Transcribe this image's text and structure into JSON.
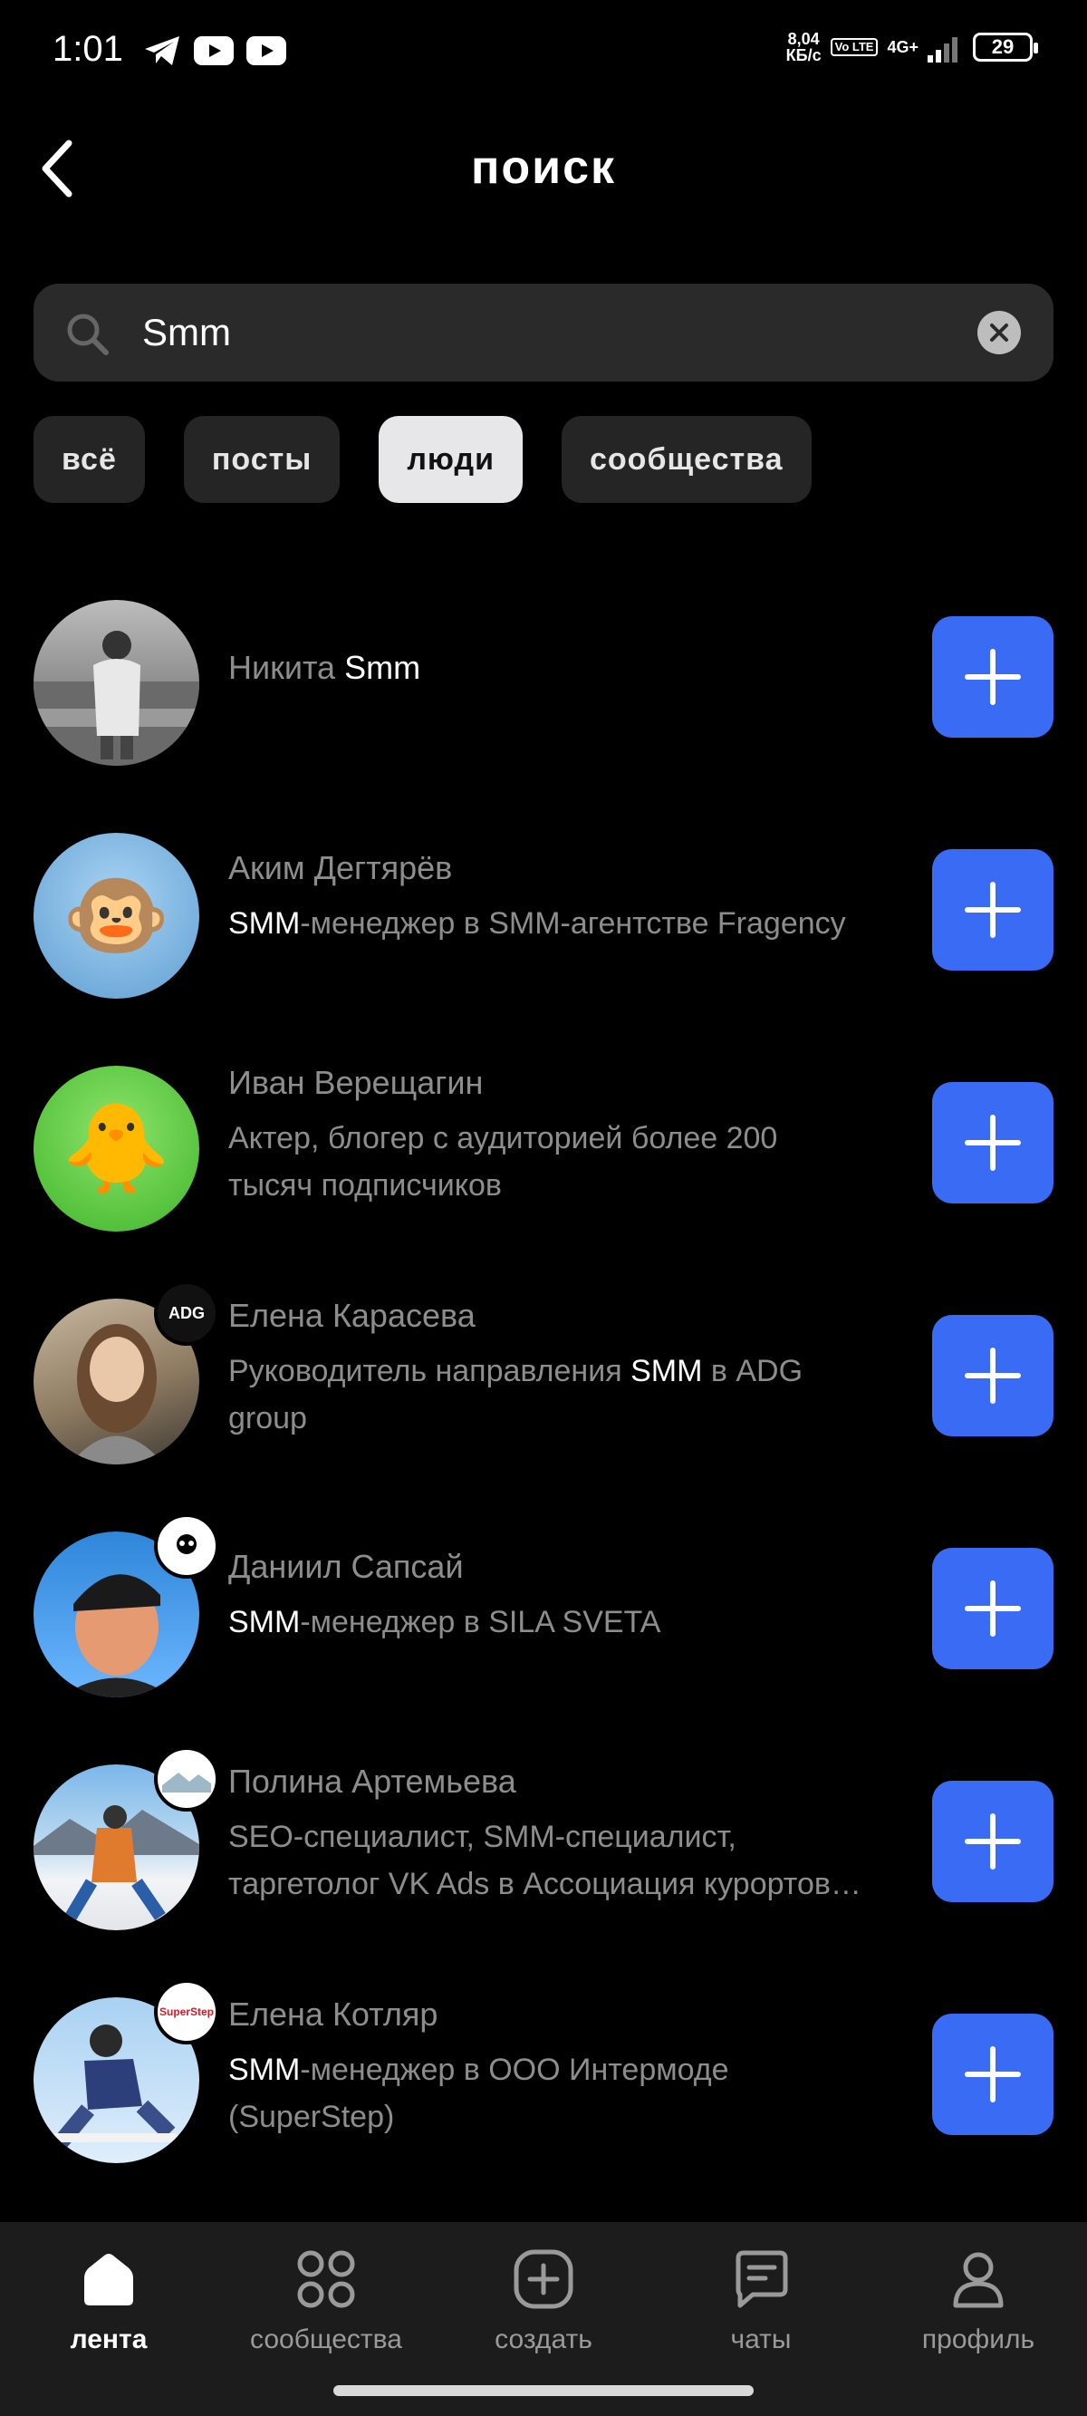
{
  "status": {
    "time": "1:01",
    "netspeed_value": "8,04",
    "netspeed_unit": "КБ/с",
    "volte": "Vo LTE",
    "network": "4G+",
    "battery": "29"
  },
  "header": {
    "title": "поиск"
  },
  "search": {
    "value": "Smm"
  },
  "chips": [
    {
      "label": "всё",
      "active": false
    },
    {
      "label": "посты",
      "active": false
    },
    {
      "label": "люди",
      "active": true
    },
    {
      "label": "сообщества",
      "active": false
    }
  ],
  "people": [
    {
      "name_first": "Никита ",
      "name_match": "Smm"
    },
    {
      "name": "Аким Дегтярёв",
      "sub_match": "SMM",
      "sub_rest": "-менеджер в SMM-агентстве Fragency",
      "avatar_emoji": "🐵"
    },
    {
      "name": "Иван Верещагин",
      "sub_line1": "Актер, блогер с аудиторией более 200",
      "sub_line2": "тысяч подписчиков",
      "avatar_emoji": "🐥"
    },
    {
      "name": "Елена Карасева",
      "sub_pre": "Руководитель направления ",
      "sub_match": "SMM",
      "sub_post": " в ADG",
      "sub_line2": "group",
      "badge": "ADG"
    },
    {
      "name": "Даниил Сапсай",
      "sub_match": "SMM",
      "sub_rest": "-менеджер в SILA SVETA",
      "badge": "СИЛА СВЕТА"
    },
    {
      "name": "Полина Артемьева",
      "sub_line1": "SEO-специалист, SMM-специалист,",
      "sub_line2": "таргетолог VK Ads в Ассоциация курортов…"
    },
    {
      "name": "Елена Котляр",
      "sub_match": "SMM",
      "sub_rest": "-менеджер в ООО Интермоде",
      "sub_line2": "(SuperStep)",
      "badge": "SuperStep"
    }
  ],
  "tabs": [
    {
      "label": "лента",
      "icon": "home-icon",
      "active": true
    },
    {
      "label": "сообщества",
      "icon": "grid-icon",
      "active": false
    },
    {
      "label": "создать",
      "icon": "plus-square-icon",
      "active": false
    },
    {
      "label": "чаты",
      "icon": "chat-icon",
      "active": false
    },
    {
      "label": "профиль",
      "icon": "person-icon",
      "active": false
    }
  ],
  "colors": {
    "accent": "#3a6bf5",
    "background": "#000000",
    "chip": "#252525",
    "chip_active": "#e7e7ea"
  }
}
